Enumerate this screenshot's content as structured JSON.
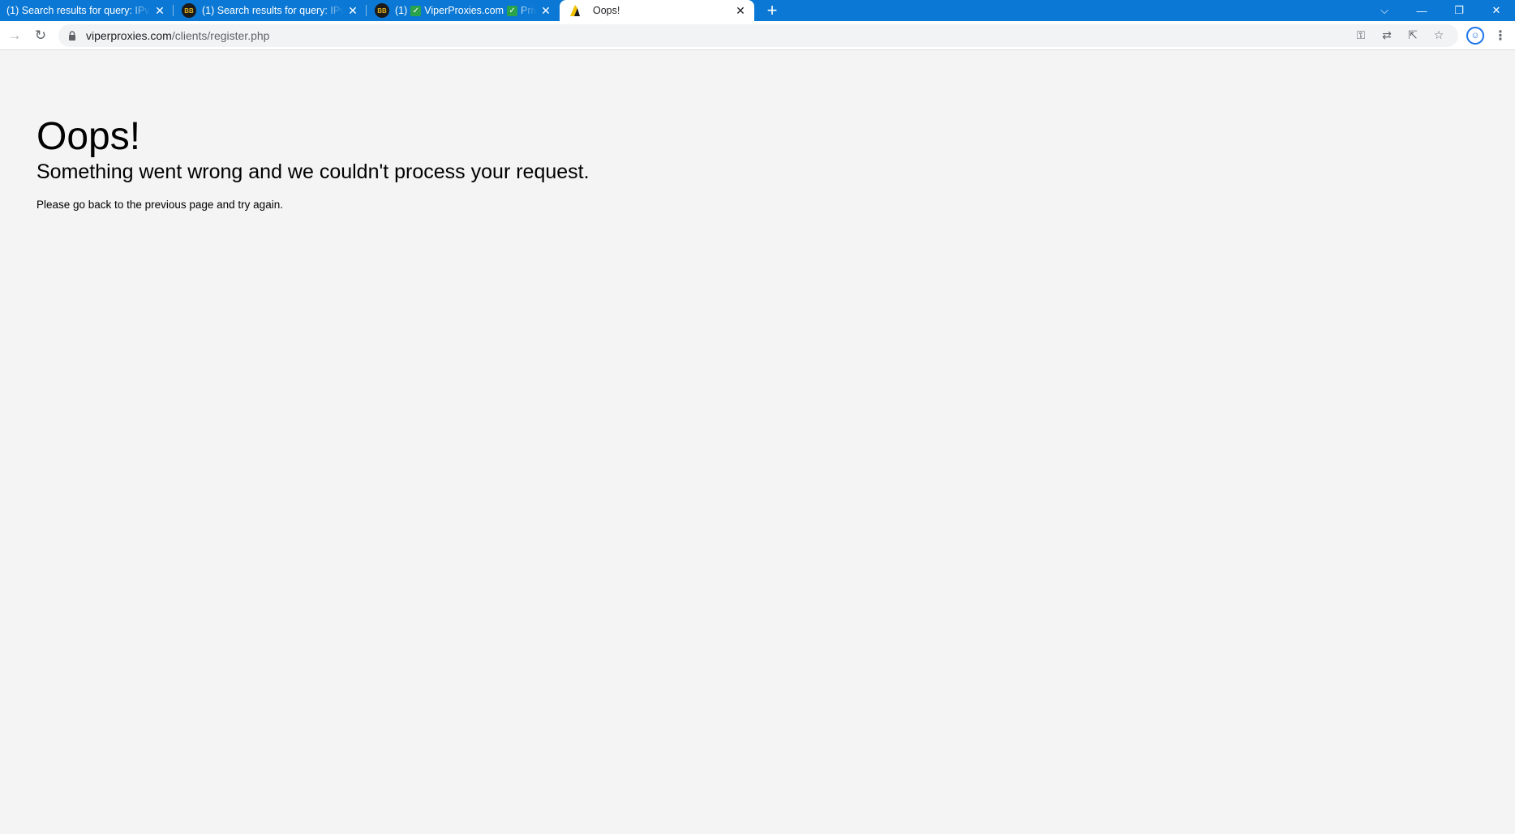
{
  "browser": {
    "tabs": [
      {
        "title": "(1) Search results for query: IPv4",
        "favicon": "forum-icon",
        "active": false
      },
      {
        "title": "(1) Search results for query: IPv4",
        "favicon": "forum-icon",
        "active": false
      },
      {
        "title_prefix": "(1)",
        "title_main": "ViperProxies.com",
        "title_suffix": "Priv",
        "favicon": "forum-icon",
        "active": false
      },
      {
        "title": "Oops!",
        "favicon": "warning-icon",
        "active": true
      }
    ],
    "new_tab_label": "+",
    "url_host": "viperproxies.com",
    "url_path": "/clients/register.php",
    "accent_color": "#0a78d4"
  },
  "page": {
    "heading": "Oops!",
    "subheading": "Something went wrong and we couldn't process your request.",
    "message": "Please go back to the previous page and try again."
  }
}
